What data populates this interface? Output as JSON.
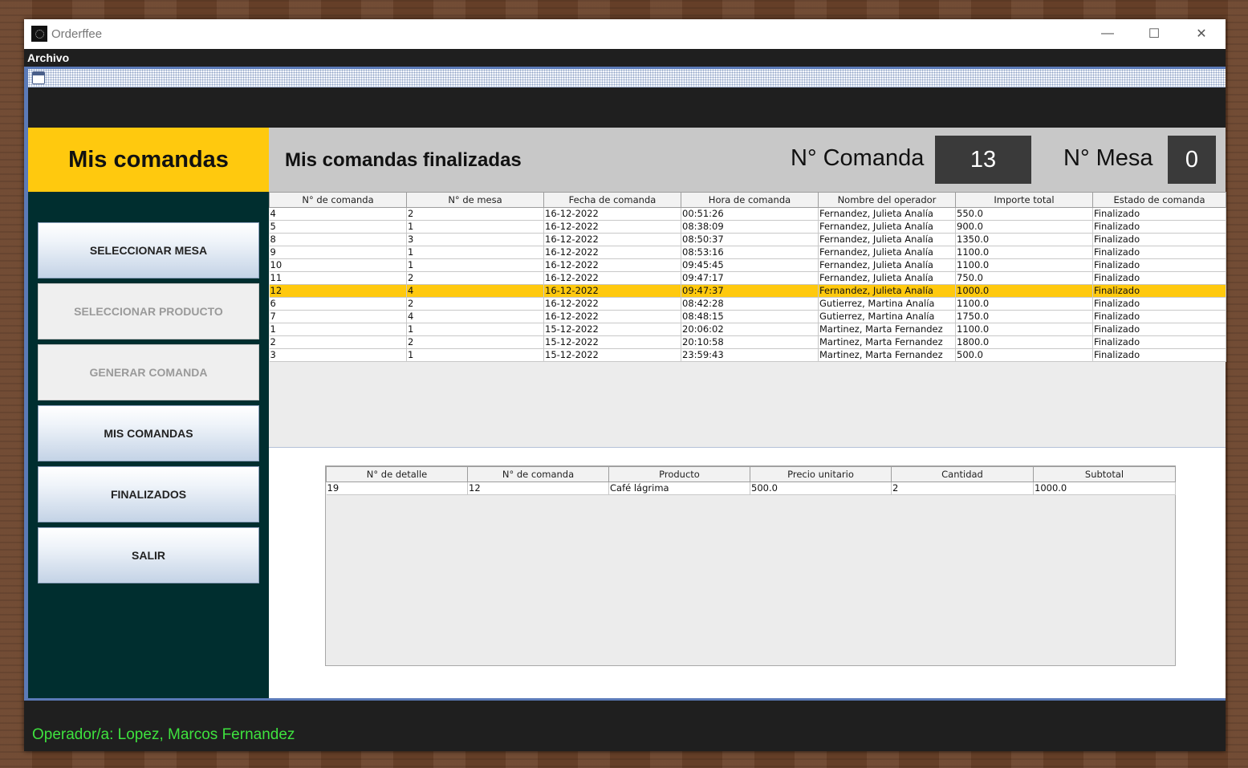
{
  "window": {
    "title": "Orderffee",
    "controls": {
      "minimize": "—",
      "maximize": "☐",
      "close": "✕"
    }
  },
  "menu": {
    "items": [
      "Archivo"
    ]
  },
  "sidebar": {
    "header": "Mis comandas",
    "buttons": [
      {
        "label": "SELECCIONAR MESA",
        "enabled": true
      },
      {
        "label": "SELECCIONAR PRODUCTO",
        "enabled": false
      },
      {
        "label": "GENERAR COMANDA",
        "enabled": false
      },
      {
        "label": "MIS COMANDAS",
        "enabled": true
      },
      {
        "label": "FINALIZADOS",
        "enabled": true
      },
      {
        "label": "SALIR",
        "enabled": true
      }
    ]
  },
  "header": {
    "title": "Mis comandas finalizadas",
    "comanda_label": "N° Comanda",
    "comanda_value": "13",
    "mesa_label": "N° Mesa",
    "mesa_value": "0"
  },
  "orders_table": {
    "columns": [
      "N° de comanda",
      "N° de mesa",
      "Fecha de comanda",
      "Hora de comanda",
      "Nombre del operador",
      "Importe total",
      "Estado de comanda"
    ],
    "selected_index": 6,
    "rows": [
      [
        "4",
        "2",
        "16-12-2022",
        "00:51:26",
        "Fernandez,  Julieta Analía",
        "550.0",
        "Finalizado"
      ],
      [
        "5",
        "1",
        "16-12-2022",
        "08:38:09",
        "Fernandez,  Julieta Analía",
        "900.0",
        "Finalizado"
      ],
      [
        "8",
        "3",
        "16-12-2022",
        "08:50:37",
        "Fernandez,  Julieta Analía",
        "1350.0",
        "Finalizado"
      ],
      [
        "9",
        "1",
        "16-12-2022",
        "08:53:16",
        "Fernandez,  Julieta Analía",
        "1100.0",
        "Finalizado"
      ],
      [
        "10",
        "1",
        "16-12-2022",
        "09:45:45",
        "Fernandez,  Julieta Analía",
        "1100.0",
        "Finalizado"
      ],
      [
        "11",
        "2",
        "16-12-2022",
        "09:47:17",
        "Fernandez,  Julieta Analía",
        "750.0",
        "Finalizado"
      ],
      [
        "12",
        "4",
        "16-12-2022",
        "09:47:37",
        "Fernandez,  Julieta Analía",
        "1000.0",
        "Finalizado"
      ],
      [
        "6",
        "2",
        "16-12-2022",
        "08:42:28",
        "Gutierrez,  Martina Analía",
        "1100.0",
        "Finalizado"
      ],
      [
        "7",
        "4",
        "16-12-2022",
        "08:48:15",
        "Gutierrez,  Martina Analía",
        "1750.0",
        "Finalizado"
      ],
      [
        "1",
        "1",
        "15-12-2022",
        "20:06:02",
        "Martinez,  Marta Fernandez",
        "1100.0",
        "Finalizado"
      ],
      [
        "2",
        "2",
        "15-12-2022",
        "20:10:58",
        "Martinez,  Marta Fernandez",
        "1800.0",
        "Finalizado"
      ],
      [
        "3",
        "1",
        "15-12-2022",
        "23:59:43",
        "Martinez,  Marta Fernandez",
        "500.0",
        "Finalizado"
      ]
    ]
  },
  "details_table": {
    "columns": [
      "N° de detalle",
      "N° de comanda",
      "Producto",
      "Precio unitario",
      "Cantidad",
      "Subtotal"
    ],
    "rows": [
      [
        "19",
        "12",
        "Café lágrima",
        "500.0",
        "2",
        "1000.0"
      ]
    ]
  },
  "status": {
    "operator": "Operador/a: Lopez, Marcos Fernandez"
  },
  "colors": {
    "accent": "#ffc90e",
    "sidebar": "#002e2f",
    "status_text": "#3ee23e",
    "frame_border": "#5b7ab8"
  }
}
